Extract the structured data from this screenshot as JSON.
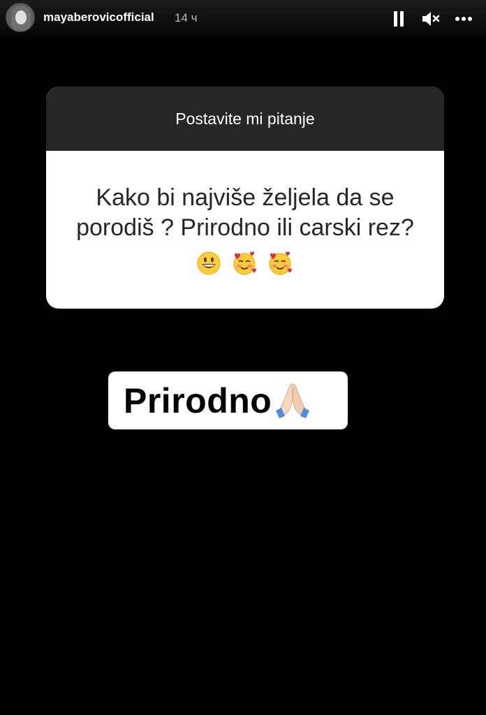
{
  "header": {
    "username": "mayaberovicofficial",
    "time": "14 ч",
    "icons": [
      "avatar",
      "pause-icon",
      "mute-icon",
      "more-icon"
    ]
  },
  "question_card": {
    "title": "Postavite mi pitanje",
    "question": "Kako bi najviše željela da se porodiš ? Prirodno ili carski rez?",
    "emojis": [
      "grinning-face-emoji",
      "smiling-face-with-hearts-emoji",
      "smiling-face-with-hearts-emoji"
    ]
  },
  "answer": {
    "text": "Prirodno",
    "emoji": "folded-hands-emoji"
  },
  "colors": {
    "background": "#000000",
    "card_header": "#262626",
    "card_body": "#ffffff"
  }
}
